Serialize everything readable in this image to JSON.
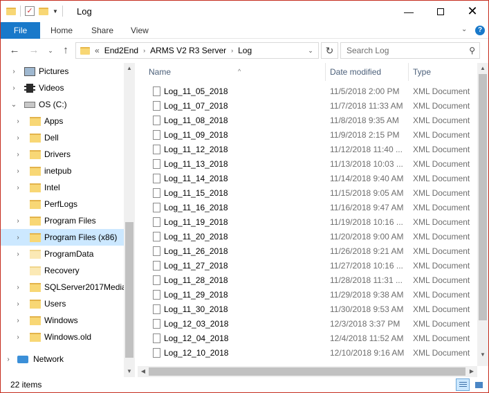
{
  "window": {
    "title": "Log"
  },
  "ribbon": {
    "file": "File",
    "tabs": [
      "Home",
      "Share",
      "View"
    ],
    "help": "?"
  },
  "address": {
    "overflow": "«",
    "crumbs": [
      "End2End",
      "ARMS V2 R3 Server",
      "Log"
    ],
    "search_placeholder": "Search Log"
  },
  "nav_pane": {
    "items": [
      {
        "label": "Pictures",
        "icon": "pictures-icon",
        "expander": "›",
        "level": 1
      },
      {
        "label": "Videos",
        "icon": "videos-icon",
        "expander": "›",
        "level": 1
      },
      {
        "label": "OS (C:)",
        "icon": "drive-icon",
        "expander": "⌄",
        "level": 1
      },
      {
        "label": "Apps",
        "icon": "folder-icon",
        "expander": "›",
        "level": 2
      },
      {
        "label": "Dell",
        "icon": "folder-icon",
        "expander": "›",
        "level": 2
      },
      {
        "label": "Drivers",
        "icon": "folder-icon",
        "expander": "›",
        "level": 2
      },
      {
        "label": "inetpub",
        "icon": "folder-icon",
        "expander": "›",
        "level": 2
      },
      {
        "label": "Intel",
        "icon": "folder-icon",
        "expander": "›",
        "level": 2
      },
      {
        "label": "PerfLogs",
        "icon": "folder-icon",
        "expander": "",
        "level": 2
      },
      {
        "label": "Program Files",
        "icon": "folder-icon",
        "expander": "›",
        "level": 2
      },
      {
        "label": "Program Files (x86)",
        "icon": "folder-icon",
        "expander": "›",
        "level": 2,
        "selected": true
      },
      {
        "label": "ProgramData",
        "icon": "folder-light-icon",
        "expander": "›",
        "level": 2
      },
      {
        "label": "Recovery",
        "icon": "folder-light-icon",
        "expander": "",
        "level": 2
      },
      {
        "label": "SQLServer2017Media",
        "icon": "folder-icon",
        "expander": "›",
        "level": 2
      },
      {
        "label": "Users",
        "icon": "folder-icon",
        "expander": "›",
        "level": 2
      },
      {
        "label": "Windows",
        "icon": "folder-icon",
        "expander": "›",
        "level": 2
      },
      {
        "label": "Windows.old",
        "icon": "folder-icon",
        "expander": "›",
        "level": 2
      },
      {
        "label": "Network",
        "icon": "network-icon",
        "expander": "›",
        "level": 0
      }
    ]
  },
  "file_list": {
    "columns": {
      "name": "Name",
      "date": "Date modified",
      "type": "Type"
    },
    "rows": [
      {
        "name": "Log_11_05_2018",
        "date": "11/5/2018 2:00 PM",
        "type": "XML Document"
      },
      {
        "name": "Log_11_07_2018",
        "date": "11/7/2018 11:33 AM",
        "type": "XML Document"
      },
      {
        "name": "Log_11_08_2018",
        "date": "11/8/2018 9:35 AM",
        "type": "XML Document"
      },
      {
        "name": "Log_11_09_2018",
        "date": "11/9/2018 2:15 PM",
        "type": "XML Document"
      },
      {
        "name": "Log_11_12_2018",
        "date": "11/12/2018 11:40 ...",
        "type": "XML Document"
      },
      {
        "name": "Log_11_13_2018",
        "date": "11/13/2018 10:03 ...",
        "type": "XML Document"
      },
      {
        "name": "Log_11_14_2018",
        "date": "11/14/2018 9:40 AM",
        "type": "XML Document"
      },
      {
        "name": "Log_11_15_2018",
        "date": "11/15/2018 9:05 AM",
        "type": "XML Document"
      },
      {
        "name": "Log_11_16_2018",
        "date": "11/16/2018 9:47 AM",
        "type": "XML Document"
      },
      {
        "name": "Log_11_19_2018",
        "date": "11/19/2018 10:16 ...",
        "type": "XML Document"
      },
      {
        "name": "Log_11_20_2018",
        "date": "11/20/2018 9:00 AM",
        "type": "XML Document"
      },
      {
        "name": "Log_11_26_2018",
        "date": "11/26/2018 9:21 AM",
        "type": "XML Document"
      },
      {
        "name": "Log_11_27_2018",
        "date": "11/27/2018 10:16 ...",
        "type": "XML Document"
      },
      {
        "name": "Log_11_28_2018",
        "date": "11/28/2018 11:31 ...",
        "type": "XML Document"
      },
      {
        "name": "Log_11_29_2018",
        "date": "11/29/2018 9:38 AM",
        "type": "XML Document"
      },
      {
        "name": "Log_11_30_2018",
        "date": "11/30/2018 9:53 AM",
        "type": "XML Document"
      },
      {
        "name": "Log_12_03_2018",
        "date": "12/3/2018 3:37 PM",
        "type": "XML Document"
      },
      {
        "name": "Log_12_04_2018",
        "date": "12/4/2018 11:52 AM",
        "type": "XML Document"
      },
      {
        "name": "Log_12_10_2018",
        "date": "12/10/2018 9:16 AM",
        "type": "XML Document"
      }
    ]
  },
  "status": {
    "item_count": "22 items"
  },
  "colors": {
    "accent": "#1979ca",
    "selection": "#cce8ff",
    "window_border": "#c42b1c",
    "header_text": "#4c607a"
  }
}
